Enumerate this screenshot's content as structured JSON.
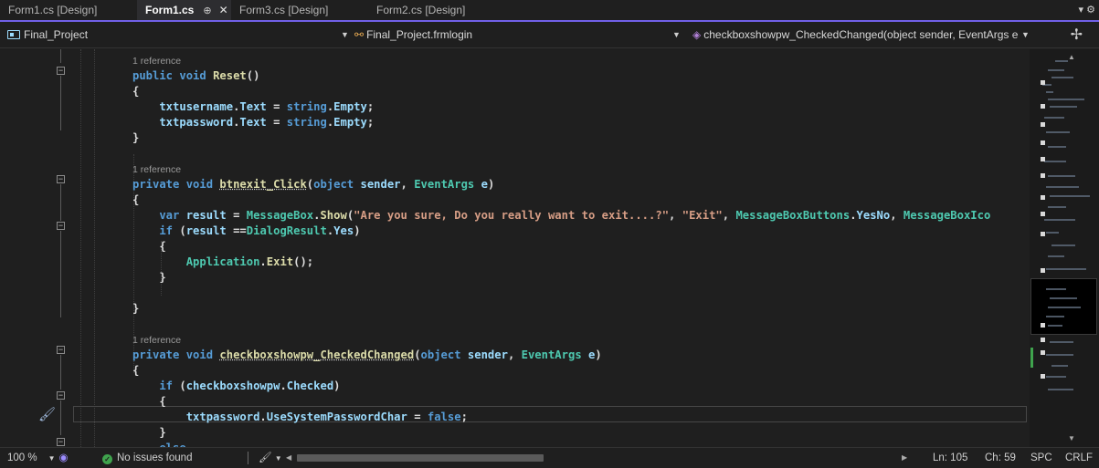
{
  "tabs": [
    {
      "label": "Form1.cs [Design]",
      "active": false
    },
    {
      "label": "Form1.cs",
      "active": true,
      "pin": "⊕",
      "close": "✕"
    },
    {
      "label": "Form3.cs [Design]",
      "active": false
    },
    {
      "label": "Form2.cs [Design]",
      "active": false
    }
  ],
  "tab_overflow": "▾ ⚙",
  "nav": {
    "project": "Final_Project",
    "class": "Final_Project.frmlogin",
    "member": "checkboxshowpw_CheckedChanged(object sender, EventArgs e"
  },
  "code_lines": [
    {
      "tokens": [
        {
          "c": "ref",
          "t": "1 reference"
        }
      ]
    },
    {
      "tokens": [
        {
          "c": "kw",
          "t": "public void "
        },
        {
          "c": "fn",
          "t": "Reset"
        },
        {
          "c": "",
          "t": "()"
        }
      ]
    },
    {
      "tokens": [
        {
          "c": "",
          "t": "{"
        }
      ]
    },
    {
      "tokens": [
        {
          "c": "id",
          "t": "    txtusername"
        },
        {
          "c": "",
          "t": "."
        },
        {
          "c": "id",
          "t": "Text"
        },
        {
          "c": "",
          "t": " = "
        },
        {
          "c": "kw",
          "t": "string"
        },
        {
          "c": "",
          "t": "."
        },
        {
          "c": "id",
          "t": "Empty"
        },
        {
          "c": "",
          "t": ";"
        }
      ]
    },
    {
      "tokens": [
        {
          "c": "id",
          "t": "    txtpassword"
        },
        {
          "c": "",
          "t": "."
        },
        {
          "c": "id",
          "t": "Text"
        },
        {
          "c": "",
          "t": " = "
        },
        {
          "c": "kw",
          "t": "string"
        },
        {
          "c": "",
          "t": "."
        },
        {
          "c": "id",
          "t": "Empty"
        },
        {
          "c": "",
          "t": ";"
        }
      ]
    },
    {
      "tokens": [
        {
          "c": "",
          "t": "}"
        }
      ]
    },
    {
      "tokens": []
    },
    {
      "tokens": [
        {
          "c": "ref",
          "t": "1 reference"
        }
      ]
    },
    {
      "tokens": [
        {
          "c": "kw",
          "t": "private void "
        },
        {
          "c": "fn sq",
          "t": "btnexit_Click"
        },
        {
          "c": "",
          "t": "("
        },
        {
          "c": "kw",
          "t": "object"
        },
        {
          "c": "id",
          "t": " sender"
        },
        {
          "c": "",
          "t": ", "
        },
        {
          "c": "ty",
          "t": "EventArgs"
        },
        {
          "c": "id",
          "t": " e"
        },
        {
          "c": "",
          "t": ")"
        }
      ]
    },
    {
      "tokens": [
        {
          "c": "",
          "t": "{"
        }
      ]
    },
    {
      "tokens": [
        {
          "c": "kw",
          "t": "    var "
        },
        {
          "c": "id",
          "t": "result"
        },
        {
          "c": "",
          "t": " = "
        },
        {
          "c": "ty",
          "t": "MessageBox"
        },
        {
          "c": "",
          "t": "."
        },
        {
          "c": "fn",
          "t": "Show"
        },
        {
          "c": "",
          "t": "("
        },
        {
          "c": "st",
          "t": "\"Are you sure, Do you really want to exit....?\""
        },
        {
          "c": "",
          "t": ", "
        },
        {
          "c": "st",
          "t": "\"Exit\""
        },
        {
          "c": "",
          "t": ", "
        },
        {
          "c": "ty",
          "t": "MessageBoxButtons"
        },
        {
          "c": "",
          "t": "."
        },
        {
          "c": "id",
          "t": "YesNo"
        },
        {
          "c": "",
          "t": ", "
        },
        {
          "c": "ty",
          "t": "MessageBoxIco"
        }
      ]
    },
    {
      "tokens": [
        {
          "c": "kw",
          "t": "    if "
        },
        {
          "c": "",
          "t": "("
        },
        {
          "c": "id",
          "t": "result"
        },
        {
          "c": "",
          "t": " =="
        },
        {
          "c": "ty",
          "t": "DialogResult"
        },
        {
          "c": "",
          "t": "."
        },
        {
          "c": "id",
          "t": "Yes"
        },
        {
          "c": "",
          "t": ")"
        }
      ]
    },
    {
      "tokens": [
        {
          "c": "",
          "t": "    {"
        }
      ]
    },
    {
      "tokens": [
        {
          "c": "ty",
          "t": "        Application"
        },
        {
          "c": "",
          "t": "."
        },
        {
          "c": "fn",
          "t": "Exit"
        },
        {
          "c": "",
          "t": "();"
        }
      ]
    },
    {
      "tokens": [
        {
          "c": "",
          "t": "    }"
        }
      ]
    },
    {
      "tokens": []
    },
    {
      "tokens": [
        {
          "c": "",
          "t": "}"
        }
      ]
    },
    {
      "tokens": []
    },
    {
      "tokens": [
        {
          "c": "ref",
          "t": "1 reference"
        }
      ]
    },
    {
      "tokens": [
        {
          "c": "kw",
          "t": "private void "
        },
        {
          "c": "fn sq",
          "t": "checkboxshowpw_CheckedChanged"
        },
        {
          "c": "",
          "t": "("
        },
        {
          "c": "kw",
          "t": "object"
        },
        {
          "c": "id",
          "t": " sender"
        },
        {
          "c": "",
          "t": ", "
        },
        {
          "c": "ty",
          "t": "EventArgs"
        },
        {
          "c": "id",
          "t": " e"
        },
        {
          "c": "",
          "t": ")"
        }
      ]
    },
    {
      "tokens": [
        {
          "c": "",
          "t": "{"
        }
      ]
    },
    {
      "tokens": [
        {
          "c": "kw",
          "t": "    if "
        },
        {
          "c": "",
          "t": "("
        },
        {
          "c": "id",
          "t": "checkboxshowpw"
        },
        {
          "c": "",
          "t": "."
        },
        {
          "c": "id",
          "t": "Checked"
        },
        {
          "c": "",
          "t": ")"
        }
      ]
    },
    {
      "tokens": [
        {
          "c": "",
          "t": "    {"
        }
      ]
    },
    {
      "tokens": [
        {
          "c": "id",
          "t": "        txtpassword"
        },
        {
          "c": "",
          "t": "."
        },
        {
          "c": "id",
          "t": "UseSystemPasswordChar"
        },
        {
          "c": "",
          "t": " = "
        },
        {
          "c": "kw",
          "t": "false"
        },
        {
          "c": "",
          "t": ";"
        }
      ]
    },
    {
      "tokens": [
        {
          "c": "",
          "t": "    }"
        }
      ]
    },
    {
      "tokens": [
        {
          "c": "kw",
          "t": "    else"
        }
      ]
    }
  ],
  "status": {
    "zoom": "100 %",
    "issues": "No issues found",
    "line": "Ln: 105",
    "col": "Ch: 59",
    "whitespace": "SPC",
    "line_ending": "CRLF"
  },
  "colors": {
    "keyword": "#569cd6",
    "method": "#dcdcaa",
    "type": "#4ec9b0",
    "identifier": "#9cdcfe",
    "string": "#d69d85",
    "accent": "#7160e8"
  }
}
